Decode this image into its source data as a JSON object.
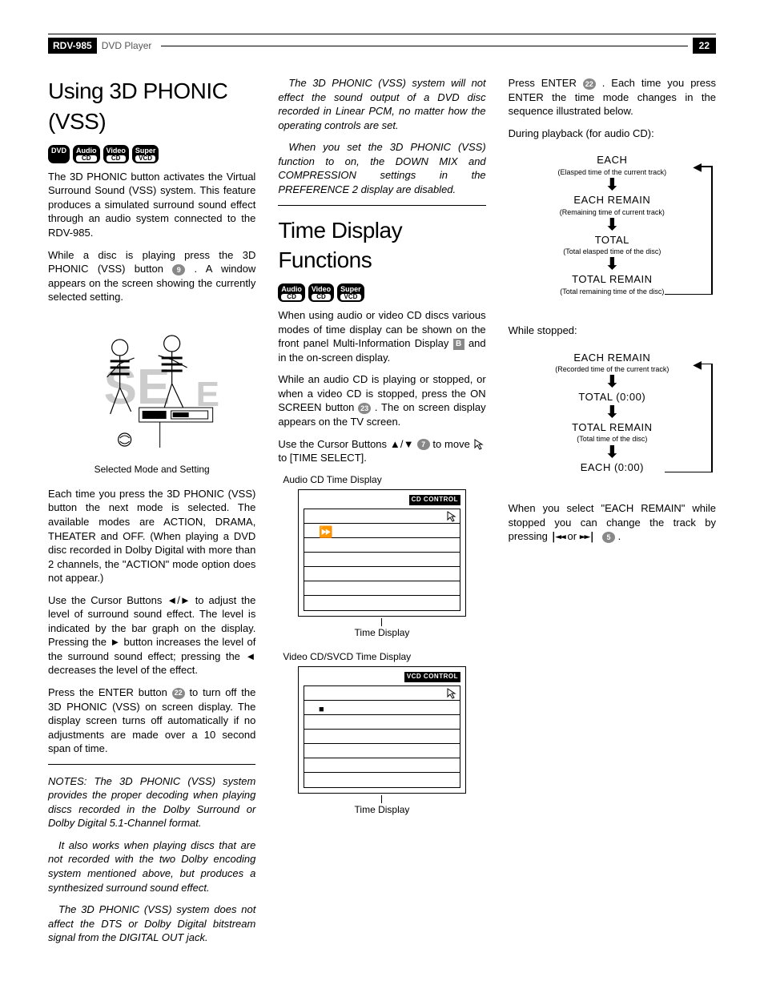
{
  "header": {
    "model": "RDV-985",
    "product": " DVD Player",
    "page": "22"
  },
  "col1": {
    "h1": "Using 3D PHONIC (VSS)",
    "badges": [
      "DVD",
      "Audio CD",
      "Video CD",
      "Super VCD"
    ],
    "p1": "The 3D PHONIC button activates the Virtual Surround Sound (VSS) system. This feature produces a simulated surround sound effect through an audio system connected to the RDV-985.",
    "p2a": "While a disc is playing press the 3D PHONIC (VSS) button ",
    "p2num": "9",
    "p2b": " . A window appears on the screen showing the currently selected setting.",
    "figGhost": "SE",
    "figCaption": "Selected Mode and Setting",
    "p3": "Each time you press the 3D PHONIC (VSS) button the next mode is selected. The available modes are ACTION, DRAMA, THEATER and OFF. (When playing a DVD disc recorded in Dolby Digital with more than 2 channels, the \"ACTION\" mode option does not appear.)",
    "p4": "Use the Cursor Buttons ◄/► to adjust the level of surround sound effect. The level is indicated by the bar graph on the display. Pressing the ► button increases the level of the surround sound effect; pressing the ◄ decreases the level of the effect.",
    "p5a": "Press the ENTER button ",
    "p5num": "22",
    "p5b": " to turn off the 3D PHONIC (VSS) on screen display. The display screen turns off automatically if no adjustments are made over a 10 second span of time.",
    "n1": "NOTES: The 3D PHONIC (VSS) system provides the proper decoding when playing discs recorded in the Dolby Surround or Dolby Digital 5.1-Channel format.",
    "n2": "It also works when playing discs that are not recorded with the two Dolby encoding system mentioned above, but produces a synthesized surround sound effect.",
    "n3": "The 3D PHONIC (VSS) system does not affect the DTS or Dolby Digital bitstream signal from the DIGITAL OUT jack."
  },
  "col2": {
    "n4": "The 3D PHONIC (VSS) system will not effect the sound output of a DVD disc recorded in Linear PCM, no matter how the operating controls are set.",
    "n5": "When you set the 3D PHONIC (VSS) function to on, the DOWN MIX and COMPRESSION settings in the PREFERENCE 2 display are disabled.",
    "h1": "Time Display Functions",
    "badges": [
      "Audio CD",
      "Video CD",
      "Super VCD"
    ],
    "p1a": "When using audio or video CD discs various modes of time display can be shown on the front panel Multi-Information Display ",
    "p1B": "B",
    "p1b": " and in the on-screen display.",
    "p2a": "While an audio CD is playing or stopped, or when a video CD is stopped, press the ON SCREEN button ",
    "p2num": "23",
    "p2b": " . The on screen display appears on the TV screen.",
    "p3a": "Use the Cursor Buttons ▲/▼ ",
    "p3num": "7",
    "p3b": " to move ",
    "p3c": " to [TIME SELECT].",
    "osd1Label": "Audio CD Time Display",
    "osd1Ctrl": "CD CONTROL",
    "osd1Caption": "Time Display",
    "osd2Label": "Video CD/SVCD Time Display",
    "osd2Ctrl": "VCD CONTROL",
    "osd2Caption": "Time Display"
  },
  "col3": {
    "p1a": "Press ENTER ",
    "p1num": "22",
    "p1b": " . Each time you press ENTER the time mode changes in the sequence illustrated below.",
    "p2": "During playback (for audio CD):",
    "seq1": [
      {
        "t": "EACH",
        "s": "(Elasped time of the current track)"
      },
      {
        "t": "EACH REMAIN",
        "s": "(Remaining time of current track)"
      },
      {
        "t": "TOTAL",
        "s": "(Total elasped time of the disc)"
      },
      {
        "t": "TOTAL REMAIN",
        "s": "(Total remaining time of the disc)"
      }
    ],
    "p3": "While stopped:",
    "seq2": [
      {
        "t": "EACH REMAIN",
        "s": "(Recorded time of the current track)"
      },
      {
        "t": "TOTAL (0:00)",
        "s": ""
      },
      {
        "t": "TOTAL REMAIN",
        "s": "(Total time of the disc)"
      },
      {
        "t": "EACH (0:00)",
        "s": ""
      }
    ],
    "p4a": "When you select \"EACH REMAIN\" while stopped you can change the track by pressing ",
    "p4icons1": "|◄◄",
    "p4mid": " or ",
    "p4icons2": "►►|",
    "p4num": "5",
    "p4b": " ."
  }
}
